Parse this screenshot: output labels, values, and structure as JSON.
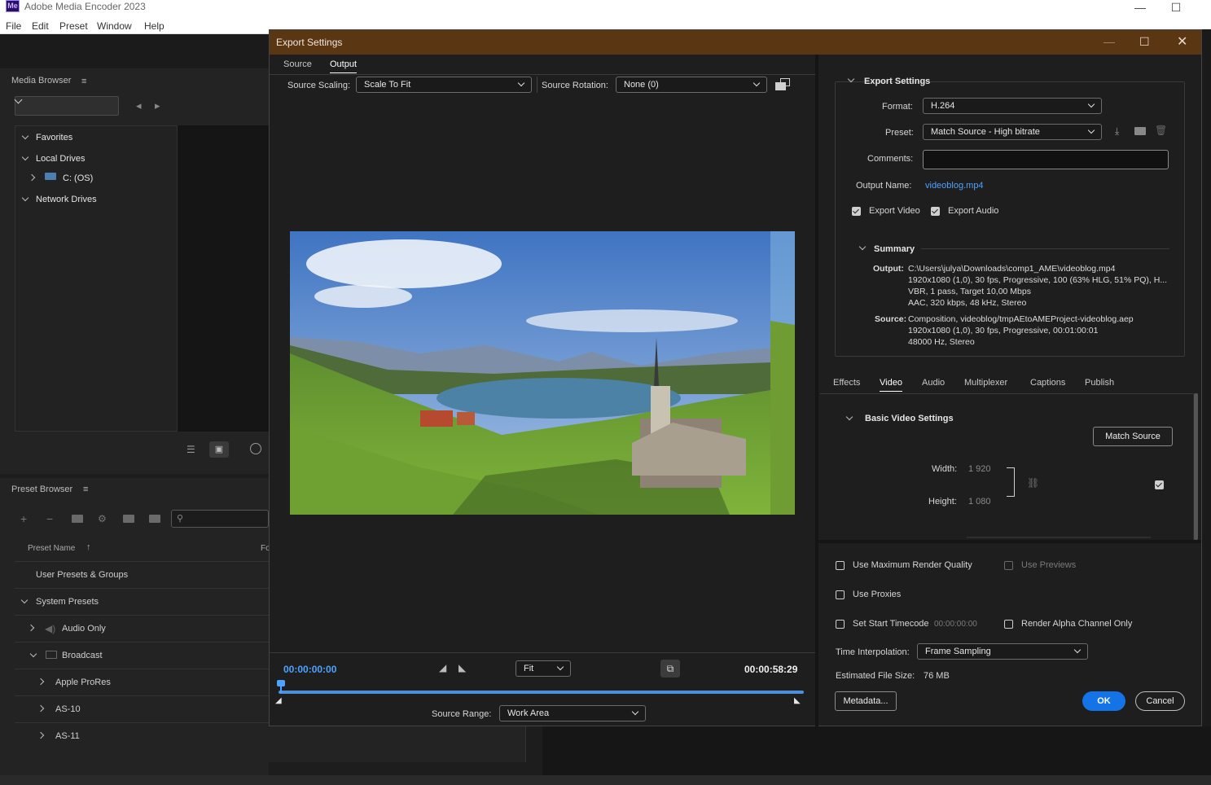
{
  "app": {
    "window_title": "Adobe Media Encoder 2023",
    "logo_text": "Me",
    "menu": [
      "File",
      "Edit",
      "Preset",
      "Window",
      "Help"
    ]
  },
  "media_browser": {
    "title": "Media Browser",
    "tree": [
      {
        "label": "Favorites"
      },
      {
        "label": "Local Drives"
      },
      {
        "label": "C: (OS)"
      },
      {
        "label": "Network Drives"
      }
    ]
  },
  "preset_browser": {
    "title": "Preset Browser",
    "column_header": "Preset Name",
    "column_header_2": "Fo",
    "rows": [
      {
        "label": "User Presets & Groups"
      },
      {
        "label": "System Presets"
      },
      {
        "label": "Audio Only"
      },
      {
        "label": "Broadcast"
      },
      {
        "label": "Apple ProRes"
      },
      {
        "label": "AS-10"
      },
      {
        "label": "AS-11"
      }
    ]
  },
  "dialog": {
    "title": "Export Settings",
    "tabs": [
      "Source",
      "Output"
    ],
    "active_tab": "Output",
    "source_scaling_label": "Source Scaling:",
    "source_scaling_value": "Scale To Fit",
    "source_rotation_label": "Source Rotation:",
    "source_rotation_value": "None (0)",
    "timecode_start": "00:00:00:00",
    "timecode_end": "00:00:58:29",
    "zoom_value": "Fit",
    "source_range_label": "Source Range:",
    "source_range_value": "Work Area",
    "playhead_progress": 0.0,
    "export_settings": {
      "section_title": "Export Settings",
      "format_label": "Format:",
      "format_value": "H.264",
      "preset_label": "Preset:",
      "preset_value": "Match Source - High bitrate",
      "comments_label": "Comments:",
      "comments_value": "",
      "output_name_label": "Output Name:",
      "output_name_value": "videoblog.mp4",
      "export_video_label": "Export Video",
      "export_video_checked": true,
      "export_audio_label": "Export Audio",
      "export_audio_checked": true
    },
    "summary": {
      "title": "Summary",
      "output_label": "Output:",
      "output_lines": [
        "C:\\Users\\julya\\Downloads\\comp1_AME\\videoblog.mp4",
        "1920x1080 (1,0), 30 fps, Progressive, 100 (63% HLG, 51% PQ), H...",
        "VBR, 1 pass, Target 10,00 Mbps",
        "AAC, 320 kbps, 48 kHz, Stereo"
      ],
      "source_label": "Source:",
      "source_lines": [
        "Composition, videoblog/tmpAEtoAMEProject-videoblog.aep",
        "1920x1080 (1,0), 30 fps, Progressive, 00:01:00:01",
        "48000 Hz, Stereo"
      ]
    },
    "settings_tabs": [
      "Effects",
      "Video",
      "Audio",
      "Multiplexer",
      "Captions",
      "Publish"
    ],
    "active_settings_tab": "Video",
    "basic_video": {
      "title": "Basic Video Settings",
      "match_source_label": "Match Source",
      "width_label": "Width:",
      "width_value": "1 920",
      "height_label": "Height:",
      "height_value": "1 080",
      "linked_checked": true
    },
    "options": {
      "max_render_quality": "Use Maximum Render Quality",
      "use_previews": "Use Previews",
      "use_proxies": "Use Proxies",
      "set_start_timecode": "Set Start Timecode",
      "start_timecode_value": "00:00:00:00",
      "render_alpha": "Render Alpha Channel Only",
      "time_interpolation_label": "Time Interpolation:",
      "time_interpolation_value": "Frame Sampling",
      "estimated_size_label": "Estimated File Size:",
      "estimated_size_value": "76 MB"
    },
    "buttons": {
      "metadata": "Metadata...",
      "ok": "OK",
      "cancel": "Cancel"
    },
    "colors": {
      "title_bar": "#5b3612",
      "accent_blue": "#1473e6",
      "timecode_blue": "#4da3ff"
    }
  }
}
